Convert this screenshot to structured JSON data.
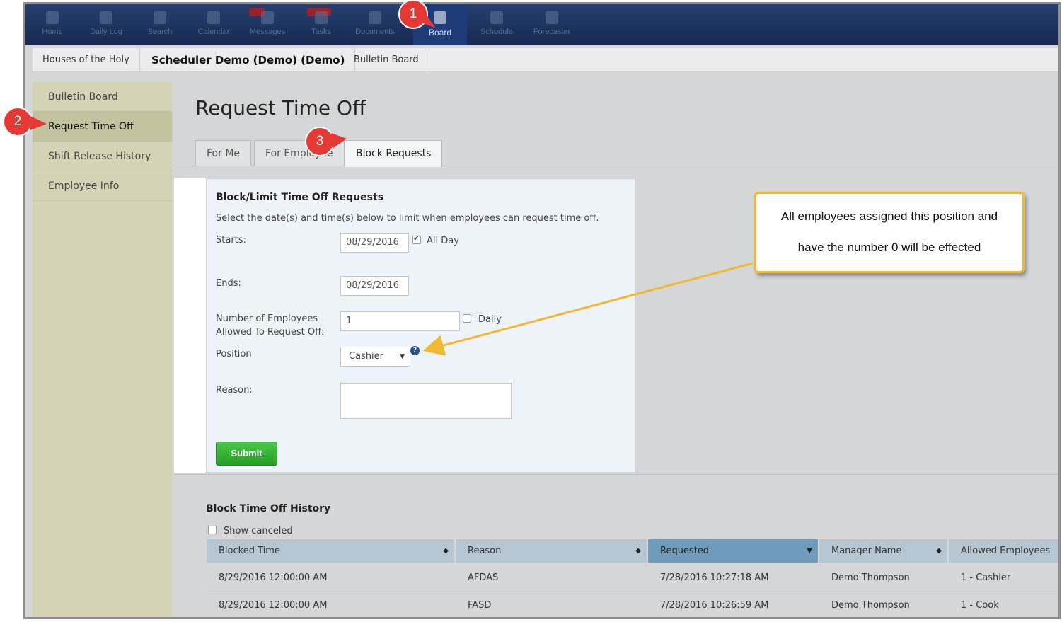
{
  "nav": {
    "items": [
      {
        "label": "Home",
        "icon": "home-icon"
      },
      {
        "label": "Daily Log",
        "icon": "log-icon"
      },
      {
        "label": "Search",
        "icon": "search-icon"
      },
      {
        "label": "Calendar",
        "icon": "calendar-icon"
      },
      {
        "label": "Messages",
        "icon": "messages-icon"
      },
      {
        "label": "Tasks",
        "icon": "tasks-icon"
      },
      {
        "label": "Documents",
        "icon": "documents-icon"
      },
      {
        "label": "Board",
        "icon": "board-icon"
      },
      {
        "label": "Schedule",
        "icon": "schedule-icon"
      },
      {
        "label": "Forecaster",
        "icon": "forecast-icon"
      }
    ],
    "active": "Board"
  },
  "breadcrumbs": [
    "Houses of the Holy",
    "Scheduler Demo (Demo) (Demo)",
    "Bulletin Board"
  ],
  "sidebar": {
    "items": [
      {
        "label": "Bulletin Board"
      },
      {
        "label": "Request Time Off"
      },
      {
        "label": "Shift Release History"
      },
      {
        "label": "Employee Info"
      }
    ]
  },
  "page": {
    "title": "Request Time Off"
  },
  "tabs": [
    {
      "label": "For Me"
    },
    {
      "label": "For Employee"
    },
    {
      "label": "Block Requests"
    }
  ],
  "form": {
    "title": "Block/Limit Time Off Requests",
    "description": "Select the date(s) and time(s) below to limit when employees can request time off.",
    "starts_label": "Starts:",
    "starts_value": "08/29/2016",
    "all_day_label": "All Day",
    "all_day_checked": true,
    "ends_label": "Ends:",
    "ends_value": "08/29/2016",
    "num_employees_label_1": "Number of Employees",
    "num_employees_label_2": "Allowed To Request Off:",
    "num_employees_value": "1",
    "daily_label": "Daily",
    "daily_checked": false,
    "position_label": "Position",
    "position_value": "Cashier",
    "help_glyph": "?",
    "reason_label": "Reason:",
    "reason_value": "",
    "submit_label": "Submit"
  },
  "history": {
    "title": "Block Time Off History",
    "show_canceled_label": "Show canceled",
    "columns": [
      "Blocked Time",
      "Reason",
      "Requested",
      "Manager Name",
      "Allowed Employees"
    ],
    "sorted_column": "Requested",
    "rows": [
      [
        "8/29/2016 12:00:00 AM",
        "AFDAS",
        "7/28/2016 10:27:18 AM",
        "Demo Thompson",
        "1 - Cashier"
      ],
      [
        "8/29/2016 12:00:00 AM",
        "FASD",
        "7/28/2016 10:26:59 AM",
        "Demo Thompson",
        "1 - Cook"
      ]
    ]
  },
  "annotations": {
    "callout_line_1": "All employees assigned this position and",
    "callout_line_2": "have the number 0 will be effected",
    "markers": [
      "1",
      "2",
      "3"
    ],
    "marker_color": "#e53935",
    "callout_border_color": "#f2b833"
  }
}
